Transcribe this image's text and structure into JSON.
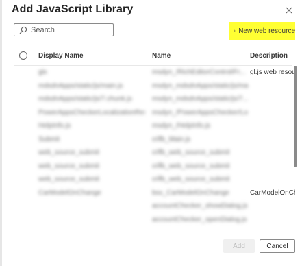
{
  "dialog": {
    "title": "Add JavaScript Library",
    "close_icon": "close-icon"
  },
  "search": {
    "placeholder": "Search",
    "value": "",
    "icon": "search-icon"
  },
  "new_web_resource": {
    "label": "New web resource",
    "icon": "plus-icon",
    "highlight_color": "#ffff33"
  },
  "table": {
    "columns": {
      "display_name": "Display Name",
      "name": "Name",
      "description": "Description"
    },
    "rows": [
      {
        "display_name": "glx",
        "name": "msdyn_/RichEditorControl/Fr...",
        "description": "gl.js web resource"
      },
      {
        "display_name": "mdsdnApps/static/js/main.js",
        "name": "msdyn_mdsdnApps/static/js/ma...",
        "description": ""
      },
      {
        "display_name": "mdsdnApps/static/js/7.chunk.js",
        "name": "msdyn_mdsdnApps/static/js/7...",
        "description": ""
      },
      {
        "display_name": "PowerAppsCheckerLocalizationResources",
        "name": "msdyn_/PowerAppsChecker/Loc...",
        "description": ""
      },
      {
        "display_name": "HelpInfo.js",
        "name": "msdyn_/HelpInfo.js",
        "description": ""
      },
      {
        "display_name": "Submit",
        "name": "crlfb_Main.js",
        "description": ""
      },
      {
        "display_name": "web_source_submit",
        "name": "crlfb_web_source_submit",
        "description": ""
      },
      {
        "display_name": "web_source_submit",
        "name": "crlfb_web_source_submit",
        "description": ""
      },
      {
        "display_name": "web_source_submit",
        "name": "crlfb_web_source_submit",
        "description": ""
      },
      {
        "display_name": "CarModelOnChange",
        "name": "bsx_CarModelOnChange",
        "description": "CarModelOnChange"
      },
      {
        "display_name": "",
        "name": "accountChecker_showDialog.js",
        "description": ""
      },
      {
        "display_name": "",
        "name": "accountChecker_openDialog.js",
        "description": ""
      }
    ]
  },
  "footer": {
    "add_label": "Add",
    "cancel_label": "Cancel"
  }
}
